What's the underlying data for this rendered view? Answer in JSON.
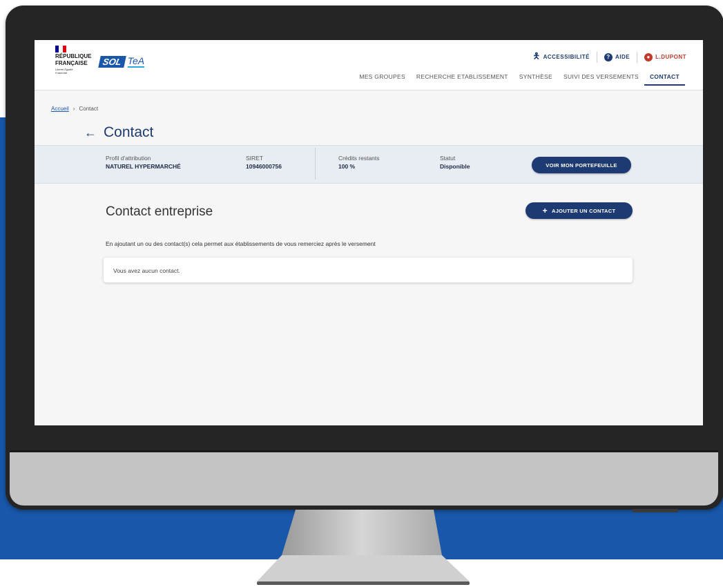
{
  "header": {
    "republique_lines": [
      "RÉPUBLIQUE",
      "FRANÇAISE"
    ],
    "republique_motto": "Liberté Égalité Fraternité",
    "app_logo_main": "SOL",
    "app_logo_sub": "TeA",
    "util": {
      "accessibility": "ACCESSIBILITÉ",
      "help": "AIDE",
      "user": "L.DUPONT"
    },
    "nav": [
      "MES GROUPES",
      "RECHERCHE ETABLISSEMENT",
      "SYNTHÈSE",
      "SUIVI DES VERSEMENTS",
      "CONTACT"
    ]
  },
  "breadcrumb": {
    "home": "Accueil",
    "current": "Contact"
  },
  "page": {
    "title": "Contact"
  },
  "infobar": {
    "profil_label": "Profil d'attribution",
    "profil_value": "NATUREL HYPERMARCHÉ",
    "siret_label": "SIRET",
    "siret_value": "10946000756",
    "credits_label": "Crédits restants",
    "credits_value": "100 %",
    "statut_label": "Statut",
    "statut_value": "Disponible",
    "portfolio_button": "VOIR MON PORTEFEUILLE"
  },
  "contact_section": {
    "title": "Contact entreprise",
    "add_button": "AJOUTER UN CONTACT",
    "description": "En ajoutant un ou des contact(s) cela permet aux établissements de vous remerciez après le versement",
    "empty_message": "Vous avez aucun contact."
  },
  "colors": {
    "primary": "#1d3b72",
    "background_blue": "#1857a9",
    "user_red": "#c0392b"
  }
}
